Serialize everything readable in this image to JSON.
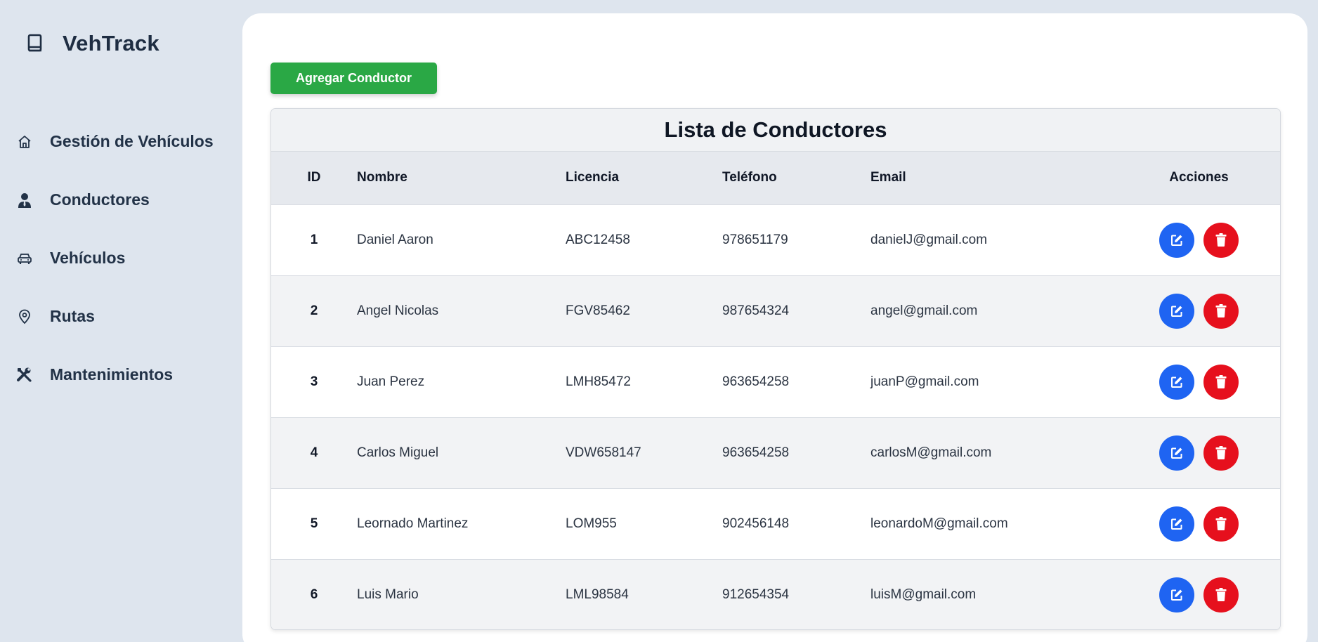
{
  "brand": {
    "name": "VehTrack",
    "icon": "book-icon"
  },
  "nav": [
    {
      "label": "Gestión de Vehículos",
      "icon": "home-icon"
    },
    {
      "label": "Conductores",
      "icon": "user-tie-icon"
    },
    {
      "label": "Vehículos",
      "icon": "car-icon"
    },
    {
      "label": "Rutas",
      "icon": "map-pin-icon"
    },
    {
      "label": "Mantenimientos",
      "icon": "tools-icon"
    }
  ],
  "actions": {
    "add_label": "Agregar Conductor"
  },
  "table": {
    "title": "Lista de Conductores",
    "headers": {
      "id": "ID",
      "name": "Nombre",
      "license": "Licencia",
      "phone": "Teléfono",
      "email": "Email",
      "actions": "Acciones"
    },
    "rows": [
      {
        "id": "1",
        "name": "Daniel Aaron",
        "license": "ABC12458",
        "phone": "978651179",
        "email": "danielJ@gmail.com"
      },
      {
        "id": "2",
        "name": "Angel Nicolas",
        "license": "FGV85462",
        "phone": "987654324",
        "email": "angel@gmail.com"
      },
      {
        "id": "3",
        "name": "Juan Perez",
        "license": "LMH85472",
        "phone": "963654258",
        "email": "juanP@gmail.com"
      },
      {
        "id": "4",
        "name": "Carlos Miguel",
        "license": "VDW658147",
        "phone": "963654258",
        "email": "carlosM@gmail.com"
      },
      {
        "id": "5",
        "name": "Leornado Martinez",
        "license": "LOM955",
        "phone": "902456148",
        "email": "leonardoM@gmail.com"
      },
      {
        "id": "6",
        "name": "Luis Mario",
        "license": "LML98584",
        "phone": "912654354",
        "email": "luisM@gmail.com"
      }
    ]
  },
  "colors": {
    "background": "#dee5ee",
    "add_button": "#2aa845",
    "edit_button": "#1f64f2",
    "delete_button": "#e6101d"
  }
}
